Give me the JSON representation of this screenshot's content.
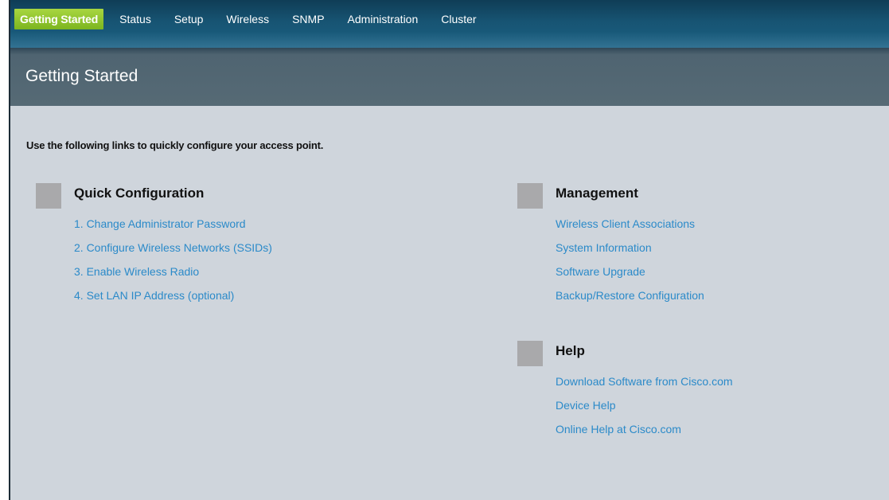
{
  "nav": {
    "tabs": [
      {
        "label": "Getting Started",
        "active": true
      },
      {
        "label": "Status",
        "active": false
      },
      {
        "label": "Setup",
        "active": false
      },
      {
        "label": "Wireless",
        "active": false
      },
      {
        "label": "SNMP",
        "active": false
      },
      {
        "label": "Administration",
        "active": false
      },
      {
        "label": "Cluster",
        "active": false
      }
    ]
  },
  "page": {
    "title": "Getting Started",
    "intro": "Use the following links to quickly configure your access point."
  },
  "sections": {
    "quick_config": {
      "heading": "Quick Configuration",
      "links": [
        "1. Change Administrator Password",
        "2. Configure Wireless Networks (SSIDs)",
        "3. Enable Wireless Radio",
        "4. Set LAN IP Address (optional)"
      ]
    },
    "management": {
      "heading": "Management",
      "links": [
        "Wireless Client Associations",
        "System Information",
        "Software Upgrade",
        "Backup/Restore Configuration"
      ]
    },
    "help": {
      "heading": "Help",
      "links": [
        "Download Software from Cisco.com",
        "Device Help",
        "Online Help at Cisco.com"
      ]
    }
  },
  "colors": {
    "active_tab": "#8cc63f",
    "link": "#2b8ac9",
    "nav_bg": "#175473",
    "title_bar_bg": "#566a75",
    "content_bg": "#cfd5dc",
    "section_marker": "#a9a9ab"
  }
}
